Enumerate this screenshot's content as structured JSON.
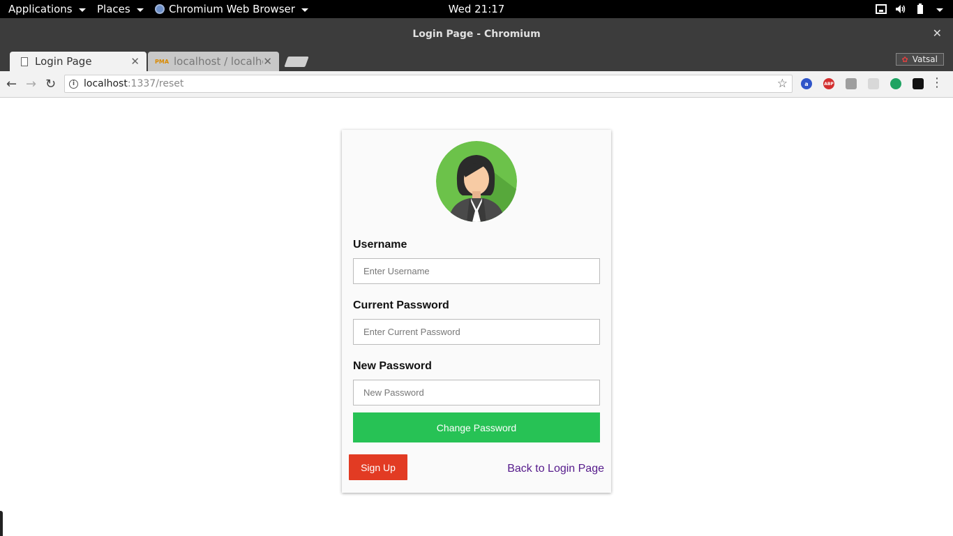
{
  "topbar": {
    "applications_label": "Applications",
    "places_label": "Places",
    "app_label": "Chromium Web Browser",
    "clock": "Wed 21:17"
  },
  "window": {
    "title": "Login Page - Chromium"
  },
  "tabs": [
    {
      "label": "Login Page",
      "active": true
    },
    {
      "label": "localhost / localhost",
      "active": false
    }
  ],
  "tab_icons": {
    "pma": "PMA"
  },
  "profile": {
    "name": "Vatsal"
  },
  "omnibox": {
    "host": "localhost",
    "path": ":1337/reset"
  },
  "extensions": [
    {
      "name": "a-extension-icon",
      "glyph": "a",
      "color": "#2f55c9"
    },
    {
      "name": "adblock-plus-icon",
      "glyph": "ABP",
      "color": "#d32f2f"
    },
    {
      "name": "mail-extension-icon",
      "glyph": "",
      "color": "#9e9e9e"
    },
    {
      "name": "cast-extension-icon",
      "glyph": "",
      "color": "#cfcfcf"
    },
    {
      "name": "hangouts-extension-icon",
      "glyph": "",
      "color": "#1ea362"
    },
    {
      "name": "gnome-extension-icon",
      "glyph": "",
      "color": "#111111"
    }
  ],
  "form": {
    "username_label": "Username",
    "username_placeholder": "Enter Username",
    "current_password_label": "Current Password",
    "current_password_placeholder": "Enter Current Password",
    "new_password_label": "New Password",
    "new_password_placeholder": "New Password",
    "change_button": "Change Password",
    "signup_button": "Sign Up",
    "back_link": "Back to Login Page"
  },
  "colors": {
    "change_button": "#27c255",
    "signup_button": "#e23b23",
    "link": "#551a8b"
  }
}
